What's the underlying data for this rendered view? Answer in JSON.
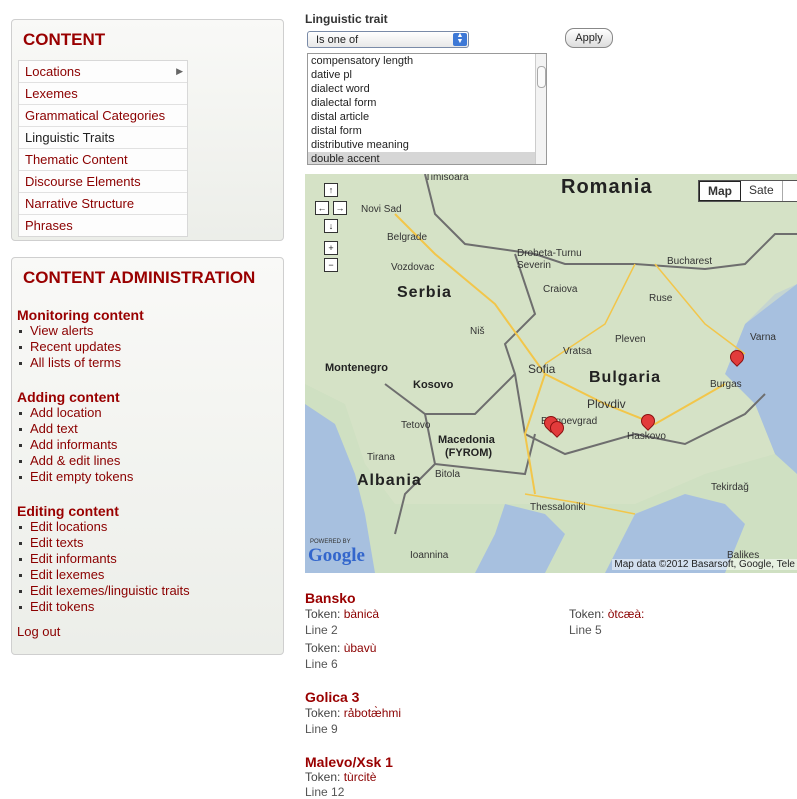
{
  "nav": {
    "title": "CONTENT",
    "items": [
      {
        "label": "Locations",
        "has_submenu": true
      },
      {
        "label": "Lexemes"
      },
      {
        "label": "Grammatical Categories"
      },
      {
        "label": "Linguistic Traits",
        "active": true
      },
      {
        "label": "Thematic Content"
      },
      {
        "label": "Discourse Elements"
      },
      {
        "label": "Narrative Structure"
      },
      {
        "label": "Phrases"
      }
    ]
  },
  "admin": {
    "title": "CONTENT ADMINISTRATION",
    "sections": [
      {
        "heading": "Monitoring content",
        "links": [
          "View alerts",
          "Recent updates",
          "All lists of terms"
        ]
      },
      {
        "heading": "Adding content",
        "links": [
          "Add location",
          "Add text",
          "Add informants",
          "Add & edit lines",
          "Edit empty tokens"
        ]
      },
      {
        "heading": "Editing content",
        "links": [
          "Edit locations",
          "Edit texts",
          "Edit informants",
          "Edit lexemes",
          "Edit lexemes/linguistic traits",
          "Edit tokens"
        ]
      }
    ],
    "logout": "Log out"
  },
  "filter": {
    "label": "Linguistic trait",
    "operator": "Is one of",
    "apply": "Apply",
    "options": [
      "compensatory length",
      "dative pl",
      "dialect word",
      "dialectal form",
      "distal article",
      "distal form",
      "distributive meaning",
      "double accent"
    ],
    "selected": "double accent"
  },
  "map": {
    "type_buttons": [
      "Map",
      "Sate"
    ],
    "active_type": "Map",
    "countries": [
      "Romania",
      "Serbia",
      "Bulgaria",
      "Albania",
      "Montenegro",
      "Kosovo",
      "Macedonia",
      "(FYROM)"
    ],
    "cities": [
      "Timisoara",
      "Novi Sad",
      "Belgrade",
      "Vozdovac",
      "Drobeta-Turnu",
      "Severin",
      "Craiova",
      "Bucharest",
      "Ruse",
      "Varna",
      "Burgas",
      "Niš",
      "Vratsa",
      "Pleven",
      "Sofia",
      "Plovdiv",
      "Blagoevgrad",
      "Haskovo",
      "Tetovo",
      "Tirana",
      "Bitola",
      "Thessaloniki",
      "Tekirdağ",
      "Ioannina",
      "Balikes"
    ],
    "attribution": "Map data ©2012 Basarsoft, Google, Tele",
    "powered_by": "POWERED BY",
    "logo": "Google",
    "markers": 4,
    "accent": "#e23b3b"
  },
  "results": [
    {
      "place": "Bansko",
      "tokens": [
        {
          "token_label": "Token:",
          "token": "bànicà",
          "line": "Line 2"
        },
        {
          "token_label": "Token:",
          "token": "òtcæà:",
          "line": "Line 5"
        },
        {
          "token_label": "Token:",
          "token": "ùbavù",
          "line": "Line 6"
        }
      ]
    },
    {
      "place": "Golica 3",
      "tokens": [
        {
          "token_label": "Token:",
          "token": "rảbotæ̀hmi",
          "line": "Line 9"
        }
      ]
    },
    {
      "place": "Malevo/Xsk 1",
      "tokens": [
        {
          "token_label": "Token:",
          "token": "tùrcitè",
          "line": "Line 12"
        }
      ]
    }
  ],
  "colors": {
    "link": "#8b0000",
    "heading": "#990000",
    "panel_bg": "#eceee9"
  }
}
